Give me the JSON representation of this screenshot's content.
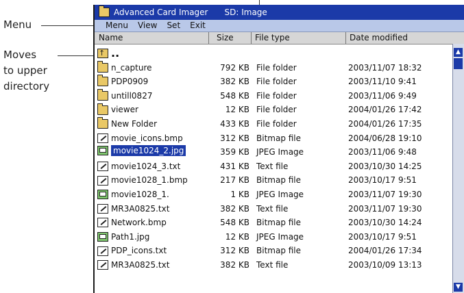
{
  "callouts": {
    "menu": "Menu",
    "upper_lines": [
      "Moves",
      "to upper",
      "directory"
    ]
  },
  "window": {
    "title": "Advanced Card Imager",
    "subtitle": "SD: Image"
  },
  "menu": [
    "Menu",
    "View",
    "Set",
    "Exit"
  ],
  "columns": [
    "Name",
    "Size",
    "File type",
    "Date modified"
  ],
  "up_label": "..",
  "rows": [
    {
      "name": "n_capture",
      "size": "792 KB",
      "type": "File folder",
      "date": "2003/11/07 18:32",
      "icon": "folder-icon"
    },
    {
      "name": "PDP0909",
      "size": "382 KB",
      "type": "File folder",
      "date": "2003/11/10 9:41",
      "icon": "folder-icon"
    },
    {
      "name": "untill0827",
      "size": "548 KB",
      "type": "File folder",
      "date": "2003/11/06 9:49",
      "icon": "folder-icon"
    },
    {
      "name": "viewer",
      "size": "12 KB",
      "type": "File folder",
      "date": "2004/01/26 17:42",
      "icon": "folder-icon"
    },
    {
      "name": "New Folder",
      "size": "433 KB",
      "type": "File folder",
      "date": "2004/01/26 17:35",
      "icon": "folder-icon"
    },
    {
      "name": "movie_icons.bmp",
      "size": "312 KB",
      "type": "Bitmap file",
      "date": "2004/06/28 19:10",
      "icon": "bitmap-icon"
    },
    {
      "name": "movie1024_2.jpg",
      "size": "359 KB",
      "type": "JPEG Image",
      "date": "2003/11/06 9:48",
      "icon": "jpeg-icon",
      "selected": true
    },
    {
      "name": "movie1024_3.txt",
      "size": "431 KB",
      "type": "Text file",
      "date": "2003/10/30 14:25",
      "icon": "text-icon"
    },
    {
      "name": "movie1028_1.bmp",
      "size": "217 KB",
      "type": "Bitmap file",
      "date": "2003/10/17 9:51",
      "icon": "bitmap-icon"
    },
    {
      "name": "movie1028_1.",
      "size": "1 KB",
      "type": "JPEG Image",
      "date": "2003/11/07 19:30",
      "icon": "jpeg-icon"
    },
    {
      "name": "MR3A0825.txt",
      "size": "382 KB",
      "type": "Text file",
      "date": "2003/11/07 19:30",
      "icon": "text-icon"
    },
    {
      "name": "Network.bmp",
      "size": "548 KB",
      "type": "Bitmap file",
      "date": "2003/10/30 14:24",
      "icon": "bitmap-icon"
    },
    {
      "name": "Path1.jpg",
      "size": "12 KB",
      "type": "JPEG Image",
      "date": "2003/10/17 9:51",
      "icon": "jpeg-icon"
    },
    {
      "name": "PDP_icons.txt",
      "size": "312 KB",
      "type": "Bitmap file",
      "date": "2004/01/26 17:34",
      "icon": "text-icon"
    },
    {
      "name": "MR3A0825.txt",
      "size": "382 KB",
      "type": "Text file",
      "date": "2003/10/09 13:13",
      "icon": "text-icon"
    }
  ],
  "scrollbar": {
    "up": "▲",
    "down": "▼"
  }
}
